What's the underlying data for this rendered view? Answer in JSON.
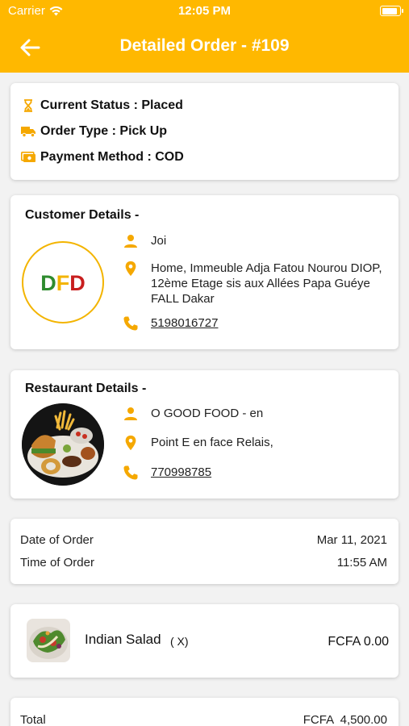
{
  "status_bar": {
    "carrier": "Carrier",
    "time": "12:05 PM",
    "battery_level": 0.92
  },
  "header": {
    "title": "Detailed Order - #109"
  },
  "order_status": {
    "items": [
      {
        "icon": "hourglass-icon",
        "text": "Current Status : Placed"
      },
      {
        "icon": "truck-icon",
        "text": "Order Type : Pick Up"
      },
      {
        "icon": "cash-icon",
        "text": "Payment Method : COD"
      }
    ]
  },
  "customer": {
    "title": "Customer Details -",
    "logo_text": "DFD",
    "name": "Joi",
    "address": "Home, Immeuble Adja Fatou Nourou DIOP, 12ème Etage sis aux Allées Papa Guéye FALL Dakar",
    "phone": "5198016727"
  },
  "restaurant": {
    "title": "Restaurant Details -",
    "name": "O GOOD FOOD - en",
    "address": "Point E en face Relais,",
    "phone": "770998785"
  },
  "dates": {
    "date_label": "Date of Order",
    "date_value": "Mar 11, 2021",
    "time_label": "Time of Order",
    "time_value": "11:55 AM"
  },
  "items": [
    {
      "name": "Indian Salad",
      "qty": "( X)",
      "price": "FCFA 0.00"
    }
  ],
  "totals": {
    "label": "Total",
    "value": "FCFA  4,500.00"
  },
  "colors": {
    "accent": "#ffb800",
    "icon": "#f5a800",
    "logo_ring": "#f3b400",
    "logo_green": "#2e8b2e",
    "logo_red": "#c81e1e"
  }
}
